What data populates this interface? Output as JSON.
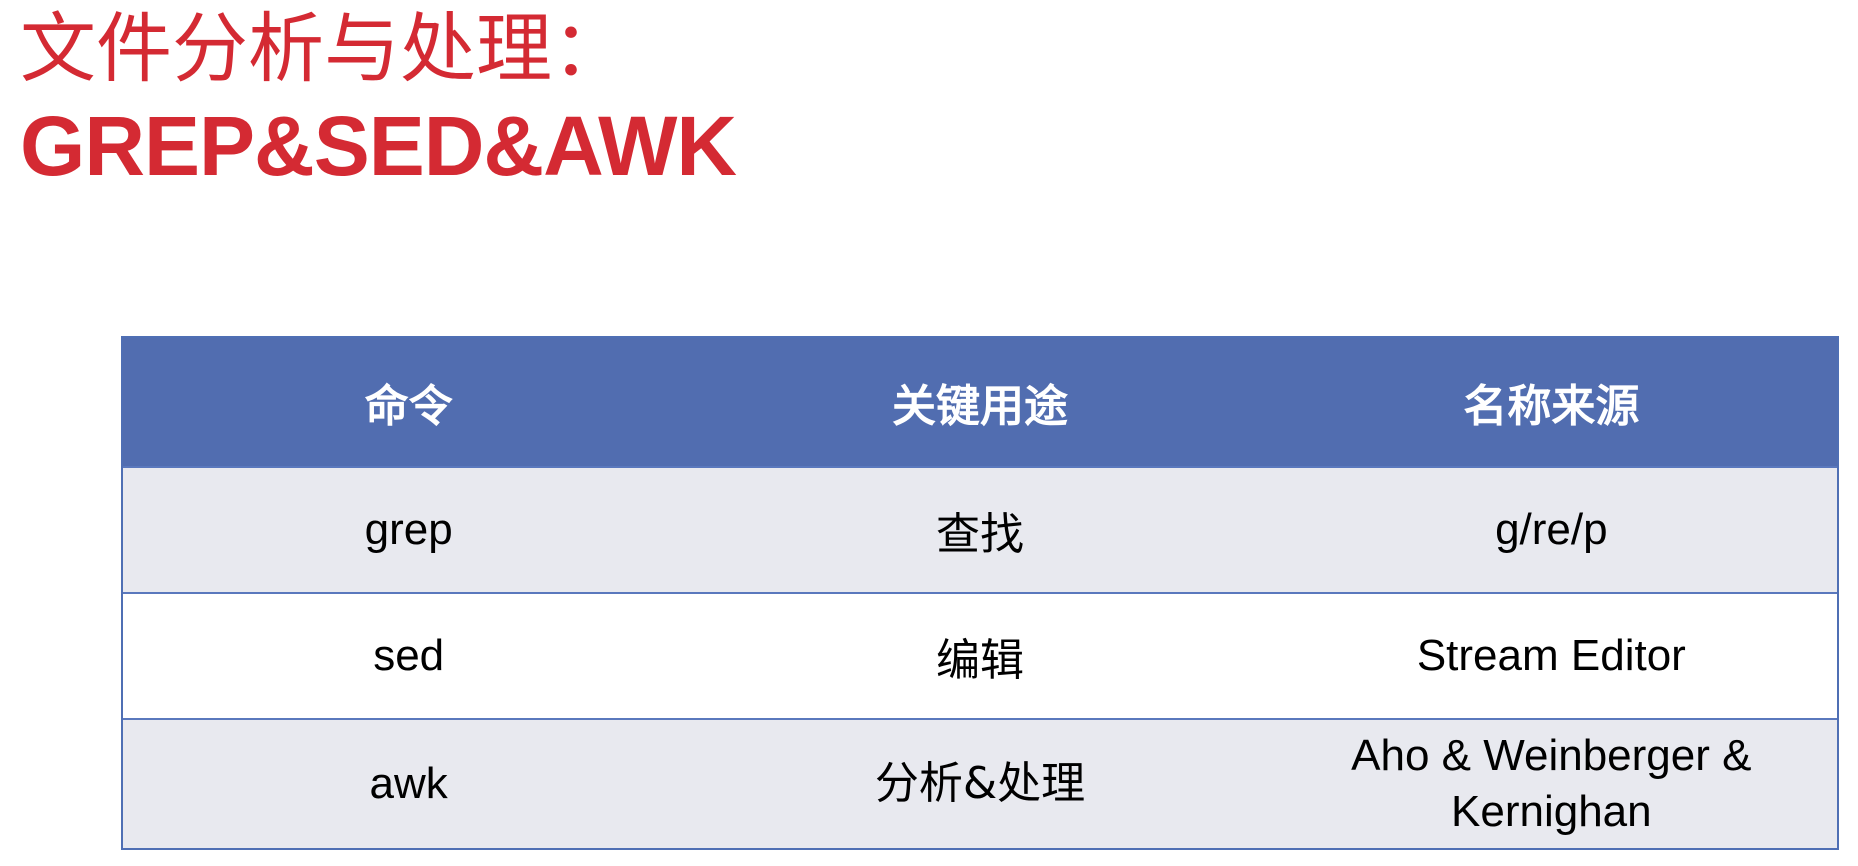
{
  "title": {
    "line1": "文件分析与处理：",
    "line2": "GREP&SED&AWK"
  },
  "table": {
    "headers": [
      "命令",
      "关键用途",
      "名称来源"
    ],
    "rows": [
      [
        "grep",
        "查找",
        "g/re/p"
      ],
      [
        "sed",
        "编辑",
        "Stream Editor"
      ],
      [
        "awk",
        "分析&处理",
        "Aho & Weinberger & Kernighan"
      ]
    ]
  },
  "colors": {
    "title": "#d42a33",
    "header_bg": "#516db0",
    "row_shaded": "#e8e9ef",
    "row_plain": "#ffffff",
    "border": "#4f6fb4"
  }
}
